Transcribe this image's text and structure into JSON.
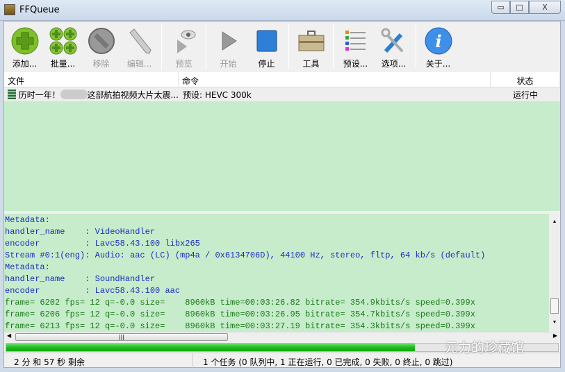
{
  "window": {
    "title": "FFQueue",
    "minimize": "▭",
    "maximize": "□",
    "close": "X"
  },
  "toolbar": [
    {
      "label": "添加...",
      "icon": "add-icon",
      "enabled": true
    },
    {
      "label": "批量...",
      "icon": "batch-add-icon",
      "enabled": true
    },
    {
      "label": "移除",
      "icon": "remove-icon",
      "enabled": false
    },
    {
      "label": "编辑...",
      "icon": "pencil-icon",
      "enabled": false
    },
    {
      "label": "预览",
      "icon": "preview-icon",
      "enabled": false
    },
    {
      "label": "开始",
      "icon": "play-icon",
      "enabled": false
    },
    {
      "label": "停止",
      "icon": "stop-icon",
      "enabled": true
    },
    {
      "label": "工具",
      "icon": "toolbox-icon",
      "enabled": true
    },
    {
      "label": "预设...",
      "icon": "presets-icon",
      "enabled": true
    },
    {
      "label": "选项...",
      "icon": "tools-icon",
      "enabled": true
    },
    {
      "label": "关于...",
      "icon": "info-icon",
      "enabled": true
    }
  ],
  "columns": {
    "file": "文件",
    "command": "命令",
    "status": "状态"
  },
  "jobs": [
    {
      "file": "历时一年！",
      "file_suffix": "这部航拍视频大片太震...",
      "command": "预设: HEVC 300k",
      "status": "运行中"
    }
  ],
  "log": [
    {
      "text": "Metadata:",
      "c": "blue"
    },
    {
      "text": "handler_name    : VideoHandler",
      "c": "blue"
    },
    {
      "text": "encoder         : Lavc58.43.100 libx265",
      "c": "blue"
    },
    {
      "text": "Stream #0:1(eng): Audio: aac (LC) (mp4a / 0x6134706D), 44100 Hz, stereo, fltp, 64 kb/s (default)",
      "c": "blue"
    },
    {
      "text": "Metadata:",
      "c": "blue"
    },
    {
      "text": "handler_name    : SoundHandler",
      "c": "blue"
    },
    {
      "text": "encoder         : Lavc58.43.100 aac",
      "c": "blue"
    },
    {
      "text": "frame= 6202 fps= 12 q=-0.0 size=    8960kB time=00:03:26.82 bitrate= 354.9kbits/s speed=0.399x",
      "c": "green"
    },
    {
      "text": "frame= 6206 fps= 12 q=-0.0 size=    8960kB time=00:03:26.95 bitrate= 354.7kbits/s speed=0.399x",
      "c": "green"
    },
    {
      "text": "frame= 6213 fps= 12 q=-0.0 size=    8960kB time=00:03:27.19 bitrate= 354.3kbits/s speed=0.399x",
      "c": "green"
    }
  ],
  "progress_percent": 74,
  "status": {
    "remaining": "2 分 和 57 秒 剩余",
    "summary": "1 个任务 (0 队列中, 1 正在运行, 0 已完成, 0 失败, 0 终止, 0 跳过)"
  },
  "watermark": "元力的珍藏馆"
}
